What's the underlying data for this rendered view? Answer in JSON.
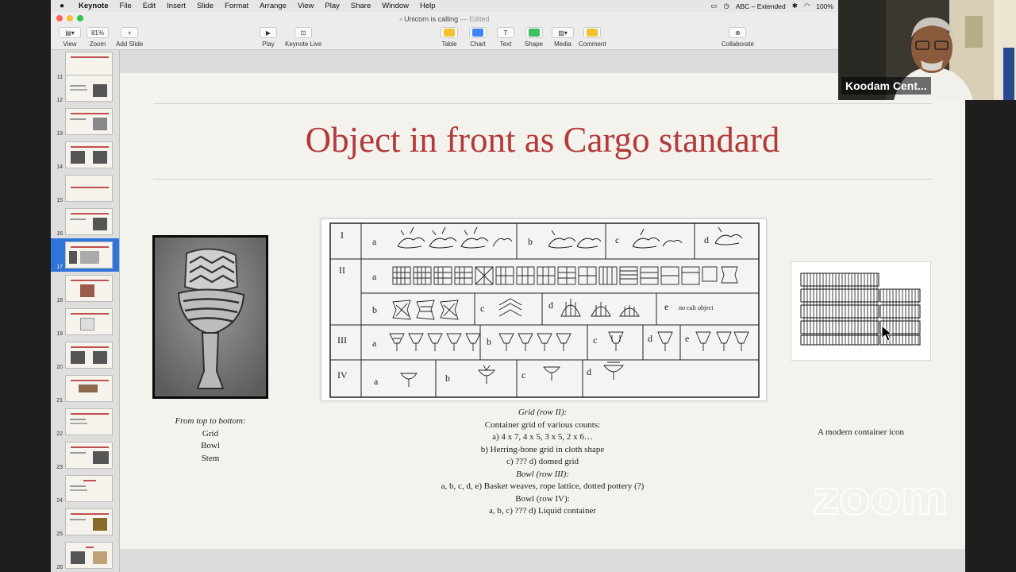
{
  "menubar": {
    "app": "Keynote",
    "items": [
      "File",
      "Edit",
      "Insert",
      "Slide",
      "Format",
      "Arrange",
      "View",
      "Play",
      "Share",
      "Window",
      "Help"
    ],
    "input_source": "ABC – Extended",
    "battery": "100%"
  },
  "window": {
    "title": "Unicorn is calling",
    "edited": "— Edited"
  },
  "toolbar": {
    "view_label": "View",
    "zoom_value": "81%",
    "zoom_label": "Zoom",
    "add_slide_label": "Add Slide",
    "play_label": "Play",
    "keynote_live_label": "Keynote Live",
    "table_label": "Table",
    "chart_label": "Chart",
    "text_label": "Text",
    "shape_label": "Shape",
    "media_label": "Media",
    "comment_label": "Comment",
    "collaborate_label": "Collaborate",
    "colors": {
      "table": "#f2c230",
      "chart": "#3b82f6",
      "shape": "#3fbf5f",
      "comment": "#f2c230"
    }
  },
  "navigator": {
    "slide_numbers": [
      "11",
      "12",
      "13",
      "14",
      "15",
      "16",
      "17",
      "18",
      "19",
      "20",
      "21",
      "22",
      "23",
      "24",
      "25",
      "26"
    ],
    "selected": "17",
    "selected_color": "#2f74d9"
  },
  "slide": {
    "title": "Object in front as Cargo standard",
    "title_color": "#b33a3a",
    "left_caption": {
      "heading": "From top to bottom:",
      "lines": [
        "Grid",
        "Bowl",
        "Stem"
      ]
    },
    "center_caption": {
      "line1": "Grid (row II):",
      "line2": "Container grid of various counts:",
      "line3": "a) 4 x 7, 4 x 5, 3 x 5, 2 x 6…",
      "line4": "b) Herring-bone grid in cloth shape",
      "line5": "c) ??? d) domed grid",
      "line6": "Bowl (row III):",
      "line7": "a, b, c, d, e) Basket weaves, rope lattice, dotted pottery (?)",
      "line8": "Bowl (row IV):",
      "line9": "a, b, c) ??? d) Liquid container"
    },
    "right_caption": "A modern container icon",
    "table": {
      "rows": [
        "I",
        "II",
        "III",
        "IV"
      ],
      "labels": [
        "a",
        "b",
        "c",
        "d",
        "e"
      ],
      "note": "no cult object"
    }
  },
  "zoom_watermark": "zoom",
  "participant": {
    "name": "Koodam Cent..."
  }
}
